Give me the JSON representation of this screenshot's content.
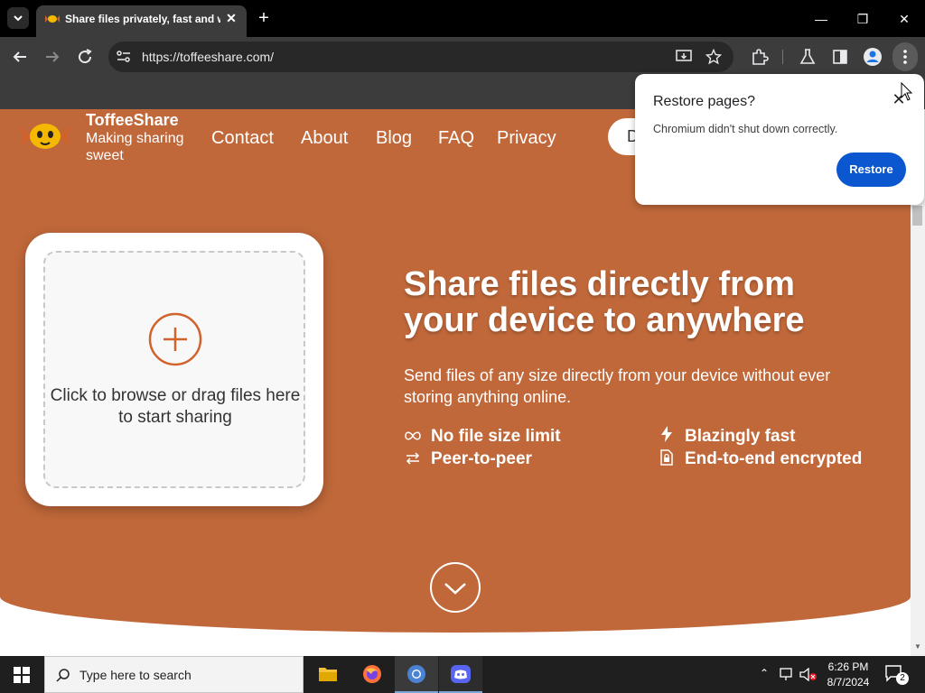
{
  "browser": {
    "tab_title": "Share files privately, fast and w",
    "url": "https://toffeeshare.com/"
  },
  "site": {
    "brand_name": "ToffeeShare",
    "brand_tagline": "Making sharing sweet",
    "nav": [
      "Contact",
      "About",
      "Blog",
      "FAQ",
      "Privacy"
    ],
    "pill_partial": "D",
    "drop_text": "Click to browse or drag files here to start sharing",
    "headline": "Share files directly from your device to anywhere",
    "subline": "Send files of any size directly from your device without ever storing anything online.",
    "features": [
      "No file size limit",
      "Peer-to-peer",
      "Blazingly fast",
      "End-to-end encrypted"
    ],
    "hero_color": "#c0683a",
    "accent_color": "#d2622b"
  },
  "popup": {
    "title": "Restore pages?",
    "message": "Chromium didn't shut down correctly.",
    "restore_label": "Restore",
    "button_color": "#0b57d0"
  },
  "taskbar": {
    "search_placeholder": "Type here to search",
    "time": "6:26 PM",
    "date": "8/7/2024",
    "notification_count": "2"
  }
}
